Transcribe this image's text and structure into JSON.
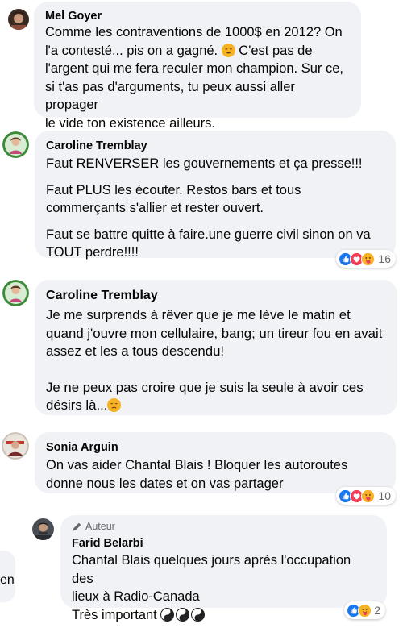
{
  "comments": [
    {
      "author": "Mel Goyer",
      "lines": [
        "Comme les contraventions de 1000$ en 2012? On",
        "l'a contesté... pis on a gagné. ",
        " C'est pas de",
        "l'argent qui me fera reculer mon champion. Sur ce,",
        "si t'as pas d'arguments, tu peux aussi aller propager",
        "le vide ton existence ailleurs."
      ]
    },
    {
      "author": "Caroline Tremblay",
      "paragraphs": [
        "Faut RENVERSER les gouvernements et ça presse!!!",
        "Faut PLUS les écouter. Restos bars et tous commerçants s'allier et rester ouvert.",
        "Faut se battre quitte à faire.une guerre civil sinon on va TOUT perdre!!!!"
      ],
      "reaction_count": "16"
    },
    {
      "author": "Caroline Tremblay",
      "paragraph1": "Je me surprends à rêver que je me lève le matin et quand j'ouvre mon cellulaire, bang; un tireur fou en avait assez et les a tous descendu!",
      "paragraph2": "Je ne peux pas croire que je suis la seule à avoir ces désirs là..."
    },
    {
      "author": "Sonia Arguin",
      "text": "On vas aider Chantal Blais ! Bloquer les autoroutes donne nous les dates et on vas partager",
      "reaction_count": "10"
    },
    {
      "author_badge": "Auteur",
      "author": "Farid Belarbi",
      "lines": [
        "Chantal Blais quelques jours après l'occupation des",
        "lieux à Radio-Canada",
        "Très important "
      ],
      "reaction_count": "2"
    }
  ],
  "left_fragment": "en",
  "icons": {
    "like": "like-icon",
    "love": "love-icon",
    "care": "care-icon",
    "haha": "haha-icon",
    "wink": "wink-emoji",
    "sad": "sad-emoji",
    "yinyang": "yin-yang-emoji",
    "pencil": "pencil-icon"
  },
  "colors": {
    "bubble": "#f0f2f5",
    "like": "#1877f2",
    "love": "#f33e58",
    "care": "#f7b125",
    "meta": "#65676b"
  }
}
